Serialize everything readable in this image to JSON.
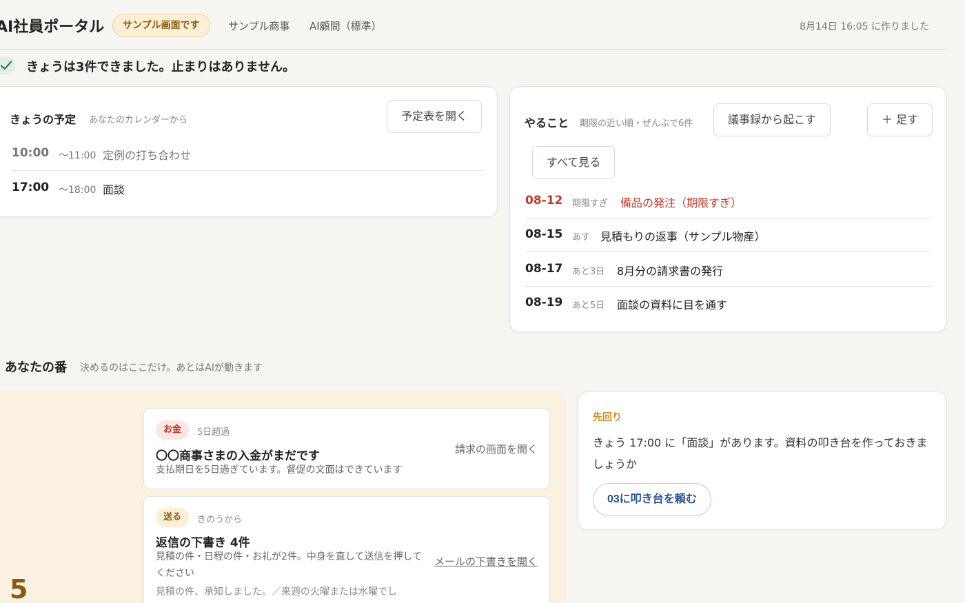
{
  "header": {
    "app_title": "AI社員ポータル",
    "sample_badge": "サンプル画面です",
    "company": "サンプル商事",
    "plan": "AI顧問（標準）",
    "generated_at": "8月14日 16:05 に作りました"
  },
  "status": {
    "message": "きょうは3件できました。止まりはありません。"
  },
  "schedule": {
    "title": "きょうの予定",
    "subtitle": "あなたのカレンダーから",
    "open_button": "予定表を開く",
    "items": [
      {
        "start": "10:00",
        "end": "〜11:00",
        "title": "定例の打ち合わせ"
      },
      {
        "start": "17:00",
        "end": "〜18:00",
        "title": "面談"
      }
    ]
  },
  "todo": {
    "title": "やること",
    "subtitle": "期限の近い順・ぜんぶで6件",
    "from_minutes_button": "議事録から起こす",
    "add_button": "＋ 足す",
    "see_all_button": "すべて見る",
    "items": [
      {
        "date": "08-12",
        "relative": "期限すぎ",
        "title": "備品の発注（期限すぎ）",
        "overdue": true
      },
      {
        "date": "08-15",
        "relative": "あす",
        "title": "見積もりの返事（サンプル物産）"
      },
      {
        "date": "08-17",
        "relative": "あと3日",
        "title": "8月分の請求書の発行"
      },
      {
        "date": "08-19",
        "relative": "あと5日",
        "title": "面談の資料に目を通す"
      }
    ]
  },
  "your_turn": {
    "title": "あなたの番",
    "subtitle": "決めるのはここだけ。あとはAIが動きます",
    "count": "5",
    "tasks": [
      {
        "tag": "お金",
        "meta": "5日超過",
        "title": "〇〇商事さまの入金がまだです",
        "description": "支払期日を5日過ぎています。督促の文面はできています",
        "link": "請求の画面を開く"
      },
      {
        "tag": "送る",
        "meta": "きのうから",
        "title": "返信の下書き 4件",
        "description": "見積の件・日程の件・お礼が2件。中身を直して送信を押してください",
        "preview": "見積の件、承知しました。／来週の火曜または水曜でし",
        "link": "メールの下書きを開く"
      }
    ]
  },
  "ahead": {
    "label": "先回り",
    "text": "きょう 17:00 に「面談」があります。資料の叩き台を作っておきましょうか",
    "button": "03に叩き台を頼む"
  },
  "colors": {
    "accent_gold": "#8a5a10",
    "overdue_red": "#c03a2b",
    "ahead_orange": "#d08a1c",
    "link_blue": "#2a4f8f",
    "check_green": "#2e8a57"
  }
}
